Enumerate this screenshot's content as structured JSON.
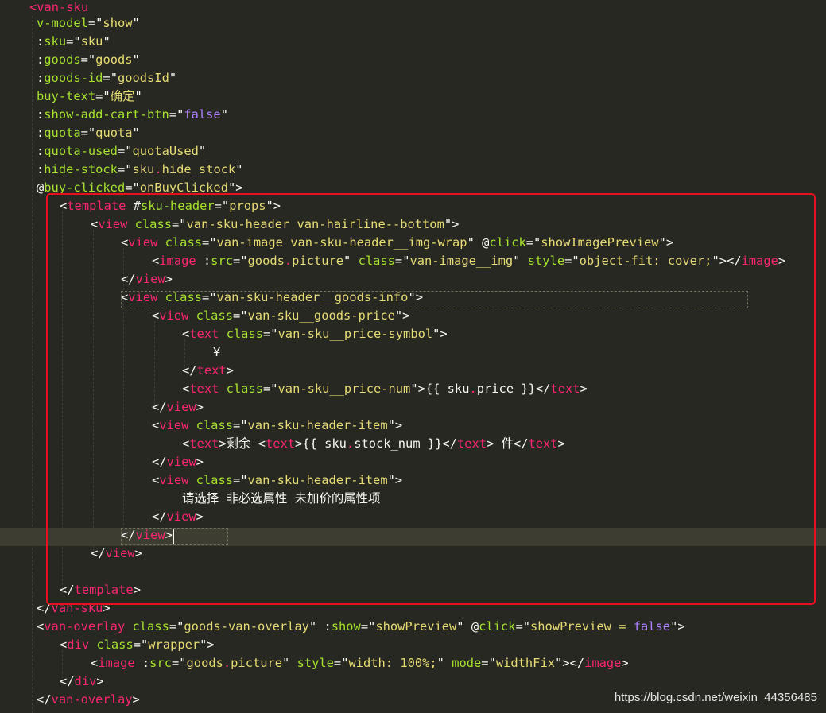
{
  "watermark": "https://blog.csdn.net/weixin_44356485",
  "code_lines": [
    [
      [
        "t",
        "<van-sku"
      ]
    ],
    [
      [
        "a",
        "v-model"
      ],
      [
        "p",
        "=\""
      ],
      [
        "s",
        "show"
      ],
      [
        "p",
        "\""
      ]
    ],
    [
      [
        "p",
        ":"
      ],
      [
        "a",
        "sku"
      ],
      [
        "p",
        "=\""
      ],
      [
        "s",
        "sku"
      ],
      [
        "p",
        "\""
      ]
    ],
    [
      [
        "p",
        ":"
      ],
      [
        "a",
        "goods"
      ],
      [
        "p",
        "=\""
      ],
      [
        "s",
        "goods"
      ],
      [
        "p",
        "\""
      ]
    ],
    [
      [
        "p",
        ":"
      ],
      [
        "a",
        "goods-id"
      ],
      [
        "p",
        "=\""
      ],
      [
        "s",
        "goodsId"
      ],
      [
        "p",
        "\""
      ]
    ],
    [
      [
        "a",
        "buy-text"
      ],
      [
        "p",
        "=\""
      ],
      [
        "s",
        "确定"
      ],
      [
        "p",
        "\""
      ]
    ],
    [
      [
        "p",
        ":"
      ],
      [
        "a",
        "show-add-cart-btn"
      ],
      [
        "p",
        "=\""
      ],
      [
        "k",
        "false"
      ],
      [
        "p",
        "\""
      ]
    ],
    [
      [
        "p",
        ":"
      ],
      [
        "a",
        "quota"
      ],
      [
        "p",
        "=\""
      ],
      [
        "s",
        "quota"
      ],
      [
        "p",
        "\""
      ]
    ],
    [
      [
        "p",
        ":"
      ],
      [
        "a",
        "quota-used"
      ],
      [
        "p",
        "=\""
      ],
      [
        "s",
        "quotaUsed"
      ],
      [
        "p",
        "\""
      ]
    ],
    [
      [
        "p",
        ":"
      ],
      [
        "a",
        "hide-stock"
      ],
      [
        "p",
        "=\""
      ],
      [
        "s",
        "sku"
      ],
      [
        "t",
        "."
      ],
      [
        "s",
        "hide_stock"
      ],
      [
        "p",
        "\""
      ]
    ],
    [
      [
        "p",
        "@"
      ],
      [
        "a",
        "buy-clicked"
      ],
      [
        "p",
        "=\""
      ],
      [
        "s",
        "onBuyClicked"
      ],
      [
        "p",
        "\">"
      ]
    ],
    [
      [
        "p",
        "<"
      ],
      [
        "t",
        "template"
      ],
      [
        "p",
        " #"
      ],
      [
        "a",
        "sku-header"
      ],
      [
        "p",
        "=\""
      ],
      [
        "s",
        "props"
      ],
      [
        "p",
        "\">"
      ]
    ],
    [
      [
        "p",
        "<"
      ],
      [
        "t",
        "view"
      ],
      [
        "p",
        " "
      ],
      [
        "a",
        "class"
      ],
      [
        "p",
        "=\""
      ],
      [
        "s",
        "van-sku-header van-hairline--bottom"
      ],
      [
        "p",
        "\">"
      ]
    ],
    [
      [
        "p",
        "<"
      ],
      [
        "t",
        "view"
      ],
      [
        "p",
        " "
      ],
      [
        "a",
        "class"
      ],
      [
        "p",
        "=\""
      ],
      [
        "s",
        "van-image van-sku-header__img-wrap"
      ],
      [
        "p",
        "\" @"
      ],
      [
        "a",
        "click"
      ],
      [
        "p",
        "=\""
      ],
      [
        "s",
        "showImagePreview"
      ],
      [
        "p",
        "\">"
      ]
    ],
    [
      [
        "p",
        "<"
      ],
      [
        "t",
        "image"
      ],
      [
        "p",
        " :"
      ],
      [
        "a",
        "src"
      ],
      [
        "p",
        "=\""
      ],
      [
        "s",
        "goods"
      ],
      [
        "t",
        "."
      ],
      [
        "s",
        "picture"
      ],
      [
        "p",
        "\" "
      ],
      [
        "a",
        "class"
      ],
      [
        "p",
        "=\""
      ],
      [
        "s",
        "van-image__img"
      ],
      [
        "p",
        "\" "
      ],
      [
        "a",
        "style"
      ],
      [
        "p",
        "=\""
      ],
      [
        "s",
        "object-fit: cover;"
      ],
      [
        "p",
        "\"></"
      ],
      [
        "t",
        "image"
      ],
      [
        "p",
        ">"
      ]
    ],
    [
      [
        "p",
        "</"
      ],
      [
        "t",
        "view"
      ],
      [
        "p",
        ">"
      ]
    ],
    [
      [
        "p",
        "<"
      ],
      [
        "t",
        "view"
      ],
      [
        "p",
        " "
      ],
      [
        "a",
        "class"
      ],
      [
        "p",
        "=\""
      ],
      [
        "s",
        "van-sku-header__goods-info"
      ],
      [
        "p",
        "\">"
      ]
    ],
    [
      [
        "p",
        "<"
      ],
      [
        "t",
        "view"
      ],
      [
        "p",
        " "
      ],
      [
        "a",
        "class"
      ],
      [
        "p",
        "=\""
      ],
      [
        "s",
        "van-sku__goods-price"
      ],
      [
        "p",
        "\">"
      ]
    ],
    [
      [
        "p",
        "<"
      ],
      [
        "t",
        "text"
      ],
      [
        "p",
        " "
      ],
      [
        "a",
        "class"
      ],
      [
        "p",
        "=\""
      ],
      [
        "s",
        "van-sku__price-symbol"
      ],
      [
        "p",
        "\">"
      ]
    ],
    [
      [
        "p",
        "¥"
      ]
    ],
    [
      [
        "p",
        "</"
      ],
      [
        "t",
        "text"
      ],
      [
        "p",
        ">"
      ]
    ],
    [
      [
        "p",
        "<"
      ],
      [
        "t",
        "text"
      ],
      [
        "p",
        " "
      ],
      [
        "a",
        "class"
      ],
      [
        "p",
        "=\""
      ],
      [
        "s",
        "van-sku__price-num"
      ],
      [
        "p",
        "\">{{ sku"
      ],
      [
        "t",
        "."
      ],
      [
        "p",
        "price }}</"
      ],
      [
        "t",
        "text"
      ],
      [
        "p",
        ">"
      ]
    ],
    [
      [
        "p",
        "</"
      ],
      [
        "t",
        "view"
      ],
      [
        "p",
        ">"
      ]
    ],
    [
      [
        "p",
        "<"
      ],
      [
        "t",
        "view"
      ],
      [
        "p",
        " "
      ],
      [
        "a",
        "class"
      ],
      [
        "p",
        "=\""
      ],
      [
        "s",
        "van-sku-header-item"
      ],
      [
        "p",
        "\">"
      ]
    ],
    [
      [
        "p",
        "<"
      ],
      [
        "t",
        "text"
      ],
      [
        "p",
        ">剩余 <"
      ],
      [
        "t",
        "text"
      ],
      [
        "p",
        ">{{ sku"
      ],
      [
        "t",
        "."
      ],
      [
        "p",
        "stock_num }}</"
      ],
      [
        "t",
        "text"
      ],
      [
        "p",
        "> 件</"
      ],
      [
        "t",
        "text"
      ],
      [
        "p",
        ">"
      ]
    ],
    [
      [
        "p",
        "</"
      ],
      [
        "t",
        "view"
      ],
      [
        "p",
        ">"
      ]
    ],
    [
      [
        "p",
        "<"
      ],
      [
        "t",
        "view"
      ],
      [
        "p",
        " "
      ],
      [
        "a",
        "class"
      ],
      [
        "p",
        "=\""
      ],
      [
        "s",
        "van-sku-header-item"
      ],
      [
        "p",
        "\">"
      ]
    ],
    [
      [
        "p",
        "请选择 非必选属性 未加价的属性项"
      ]
    ],
    [
      [
        "p",
        "</"
      ],
      [
        "t",
        "view"
      ],
      [
        "p",
        ">"
      ]
    ],
    [
      [
        "p",
        "</"
      ],
      [
        "t",
        "view"
      ],
      [
        "p",
        ">"
      ]
    ],
    [
      [
        "p",
        "</"
      ],
      [
        "t",
        "view"
      ],
      [
        "p",
        ">"
      ]
    ],
    [],
    [
      [
        "p",
        "</"
      ],
      [
        "t",
        "template"
      ],
      [
        "p",
        ">"
      ]
    ],
    [
      [
        "p",
        "</"
      ],
      [
        "t",
        "van-sku"
      ],
      [
        "p",
        ">"
      ]
    ],
    [
      [
        "p",
        "<"
      ],
      [
        "t",
        "van-overlay"
      ],
      [
        "p",
        " "
      ],
      [
        "a",
        "class"
      ],
      [
        "p",
        "=\""
      ],
      [
        "s",
        "goods-van-overlay"
      ],
      [
        "p",
        "\" :"
      ],
      [
        "a",
        "show"
      ],
      [
        "p",
        "=\""
      ],
      [
        "s",
        "showPreview"
      ],
      [
        "p",
        "\" @"
      ],
      [
        "a",
        "click"
      ],
      [
        "p",
        "=\""
      ],
      [
        "s",
        "showPreview = "
      ],
      [
        "k",
        "false"
      ],
      [
        "p",
        "\">"
      ]
    ],
    [
      [
        "p",
        "<"
      ],
      [
        "t",
        "div"
      ],
      [
        "p",
        " "
      ],
      [
        "a",
        "class"
      ],
      [
        "p",
        "=\""
      ],
      [
        "s",
        "wrapper"
      ],
      [
        "p",
        "\">"
      ]
    ],
    [
      [
        "p",
        "<"
      ],
      [
        "t",
        "image"
      ],
      [
        "p",
        " :"
      ],
      [
        "a",
        "src"
      ],
      [
        "p",
        "=\""
      ],
      [
        "s",
        "goods"
      ],
      [
        "t",
        "."
      ],
      [
        "s",
        "picture"
      ],
      [
        "p",
        "\" "
      ],
      [
        "a",
        "style"
      ],
      [
        "p",
        "=\""
      ],
      [
        "s",
        "width: 100%;"
      ],
      [
        "p",
        "\" "
      ],
      [
        "a",
        "mode"
      ],
      [
        "p",
        "=\""
      ],
      [
        "s",
        "widthFix"
      ],
      [
        "p",
        "\"></"
      ],
      [
        "t",
        "image"
      ],
      [
        "p",
        ">"
      ]
    ],
    [
      [
        "p",
        "</"
      ],
      [
        "t",
        "div"
      ],
      [
        "p",
        ">"
      ]
    ],
    [
      [
        "p",
        "</"
      ],
      [
        "t",
        "van-overlay"
      ],
      [
        "p",
        ">"
      ]
    ]
  ]
}
